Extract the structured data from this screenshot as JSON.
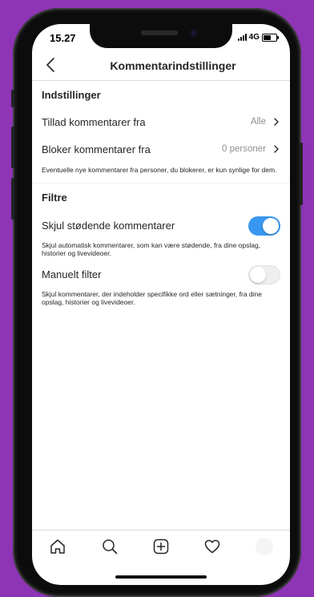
{
  "status_bar": {
    "time": "15.27",
    "network": "4G"
  },
  "header": {
    "title": "Kommentarindstillinger",
    "back_icon": "chevron-left-icon"
  },
  "settings": {
    "title": "Indstillinger",
    "allow_comments": {
      "label": "Tillad kommentarer fra",
      "value": "Alle"
    },
    "block_comments": {
      "label": "Bloker kommentarer fra",
      "value": "0 personer"
    },
    "description": "Eventuelle nye kommentarer fra personer, du blokerer, er kun synlige for dem."
  },
  "filters": {
    "title": "Filtre",
    "hide_offensive": {
      "label": "Skjul stødende kommentarer",
      "enabled": true,
      "description": "Skjul automatisk kommentarer, som kan være stødende, fra dine opslag, historier og livevideoer."
    },
    "manual_filter": {
      "label": "Manuelt filter",
      "enabled": false,
      "description": "Skjul kommentarer, der indeholder specifikke ord eller sætninger, fra dine opslag, historier og livevideoer."
    }
  },
  "tab_bar": {
    "items": [
      "home-icon",
      "search-icon",
      "add-post-icon",
      "heart-icon",
      "profile-avatar"
    ]
  },
  "colors": {
    "background": "#8e35b5",
    "toggle_on": "#3897f0",
    "toggle_off": "#efefef",
    "secondary_text": "#8e8e8e"
  }
}
